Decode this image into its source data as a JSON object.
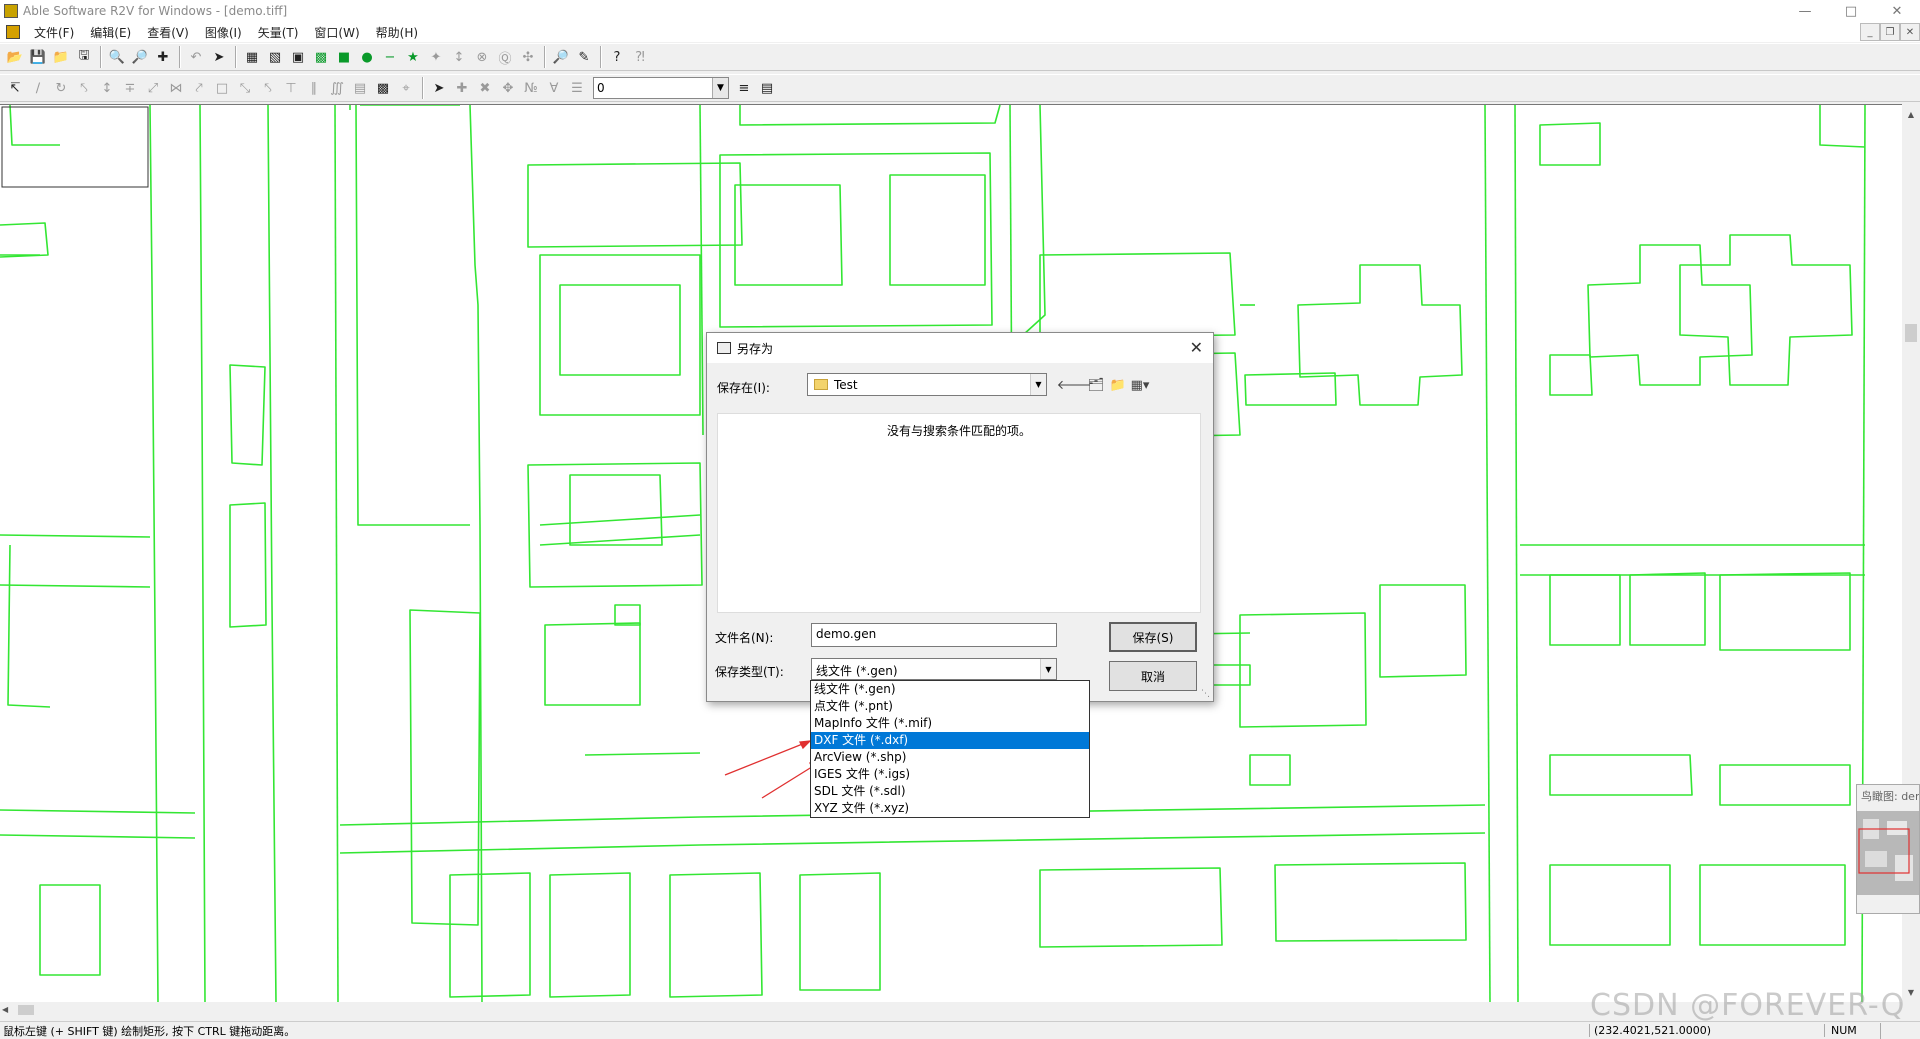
{
  "window": {
    "title": "Able Software R2V for Windows - [demo.tiff]",
    "minimize_icon": "minimize-icon",
    "maximize_icon": "maximize-icon",
    "close_icon": "close-icon"
  },
  "menubar": {
    "items": [
      {
        "label": "文件(F)"
      },
      {
        "label": "编辑(E)"
      },
      {
        "label": "查看(V)"
      },
      {
        "label": "图像(I)"
      },
      {
        "label": "矢量(T)"
      },
      {
        "label": "窗口(W)"
      },
      {
        "label": "帮助(H)"
      }
    ]
  },
  "toolbar2": {
    "layer_value": "0"
  },
  "statusbar": {
    "message": "鼠标左键 (+ SHIFT 键) 绘制矩形, 按下 CTRL 键拖动距离。",
    "coordinates": "(232.4021,521.0000)",
    "num": "NUM"
  },
  "overview": {
    "title": "鸟瞰图: demo"
  },
  "watermark": "CSDN @FOREVER-Q",
  "dialog": {
    "title": "另存为",
    "save_in_label": "保存在(I):",
    "save_in_value": "Test",
    "empty_message": "没有与搜索条件匹配的项。",
    "filename_label": "文件名(N):",
    "filename_value": "demo.gen",
    "filetype_label": "保存类型(T):",
    "filetype_value": "线文件 (*.gen)",
    "save_button": "保存(S)",
    "cancel_button": "取消",
    "filetype_options": [
      {
        "label": "线文件 (*.gen)"
      },
      {
        "label": "点文件 (*.pnt)"
      },
      {
        "label": "MapInfo 文件 (*.mif)"
      },
      {
        "label": "DXF 文件 (*.dxf)"
      },
      {
        "label": "ArcView (*.shp)"
      },
      {
        "label": "IGES 文件 (*.igs)"
      },
      {
        "label": "SDL 文件 (*.sdl)"
      },
      {
        "label": "XYZ 文件 (*.xyz)"
      }
    ],
    "selected_option_index": 3
  },
  "colors": {
    "vector_lines": "#33e633",
    "selection": "#0078d7",
    "annotation_arrow": "#e03030"
  }
}
